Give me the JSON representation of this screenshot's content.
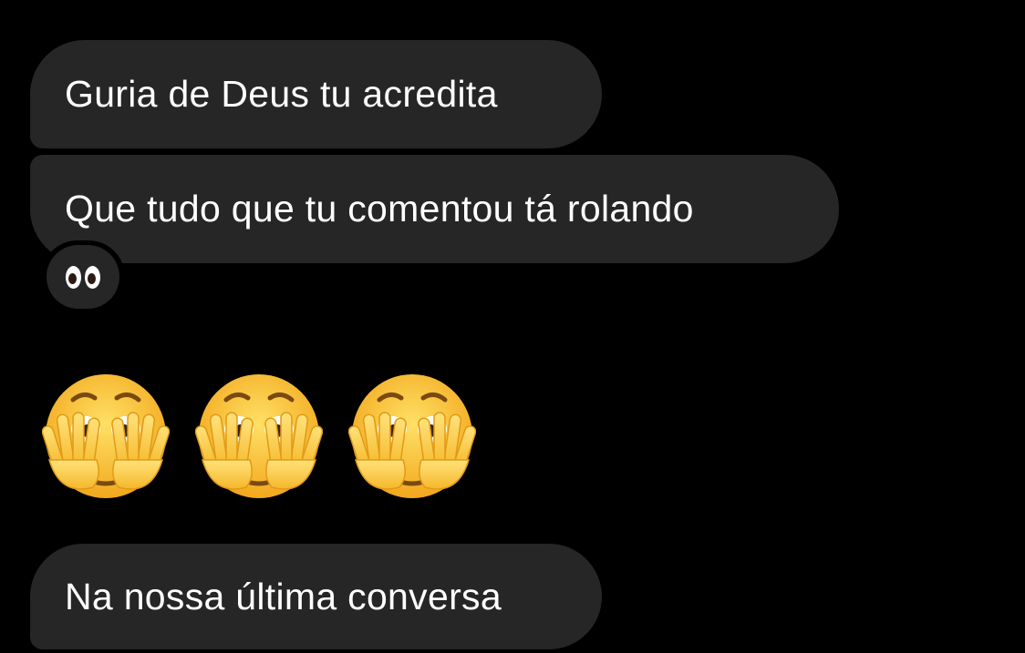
{
  "messages": [
    {
      "text": "Guria de Deus tu acredita"
    },
    {
      "text": "Que tudo que tu comentou tá rolando"
    },
    {
      "text": "Na nossa última conversa"
    }
  ],
  "reaction": {
    "icon": "eyes-icon"
  },
  "emoji_message": {
    "icons": [
      "face-hands-over-eyes-icon",
      "face-hands-over-eyes-icon",
      "face-hands-over-eyes-icon"
    ]
  },
  "colors": {
    "background": "#000000",
    "bubble": "#262626",
    "text": "#ffffff",
    "emoji_face": "#f7c028"
  }
}
